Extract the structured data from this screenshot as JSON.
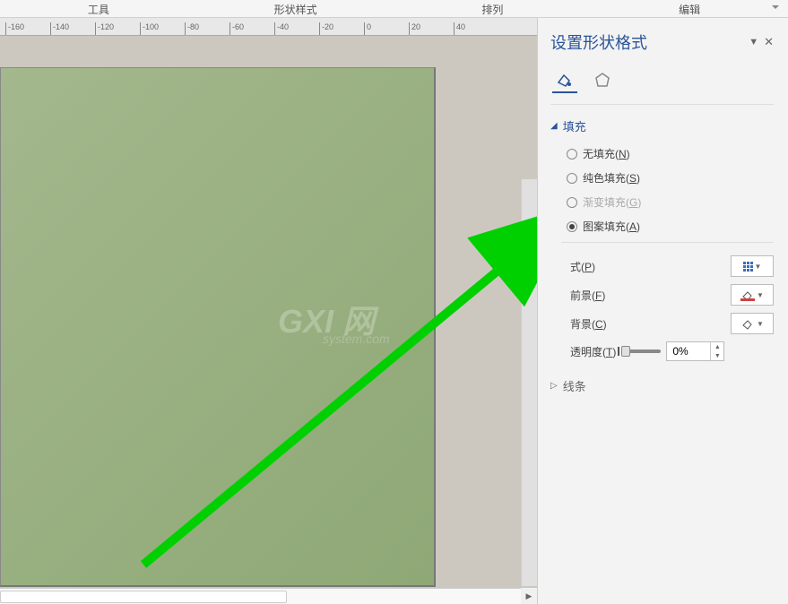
{
  "tabs": {
    "tools": "工具",
    "shape_style": "形状样式",
    "arrange": "排列",
    "edit": "编辑"
  },
  "ruler": [
    "-160",
    "-140",
    "-120",
    "-100",
    "-80",
    "-60",
    "-40",
    "-20",
    "0",
    "20",
    "40"
  ],
  "panel": {
    "title": "设置形状格式",
    "sections": {
      "fill": "填充",
      "line": "线条"
    },
    "fill_options": {
      "none": {
        "label": "无填充(",
        "key": "N",
        "suffix": ")"
      },
      "solid": {
        "label": "纯色填充(",
        "key": "S",
        "suffix": ")"
      },
      "gradient": {
        "label": "渐变填充(",
        "key": "G",
        "suffix": ")"
      },
      "pattern": {
        "label": "图案填充(",
        "key": "A",
        "suffix": ")"
      }
    },
    "controls": {
      "pattern": {
        "label": "式(",
        "key": "P",
        "suffix": ")"
      },
      "foreground": {
        "label": "前景(",
        "key": "F",
        "suffix": ")"
      },
      "background": {
        "label": "背景(",
        "key": "C",
        "suffix": ")"
      },
      "transparency": {
        "label": "透明度(",
        "key": "T",
        "suffix": ")",
        "value": "0%"
      }
    }
  },
  "watermark": {
    "main": "GXI 网",
    "sub": "system.com"
  }
}
